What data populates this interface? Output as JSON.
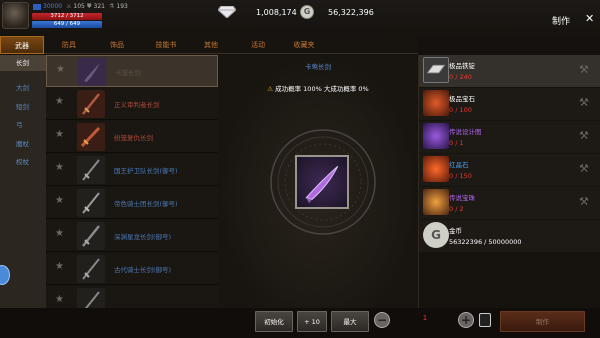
{
  "header": {
    "level_text": "30000",
    "stat1": "105",
    "stat2": "321",
    "stat3": "193",
    "hp": "3712 / 3712",
    "mp": "649 / 649",
    "diamonds": "1,008,174",
    "coin_symbol": "G",
    "gold": "56,322,396",
    "title": "制作",
    "close_glyph": "✕"
  },
  "tabs": [
    {
      "label": "武器"
    },
    {
      "label": "防具"
    },
    {
      "label": "饰品"
    },
    {
      "label": "技能书"
    },
    {
      "label": "其他"
    },
    {
      "label": "活动"
    },
    {
      "label": "收藏夹"
    }
  ],
  "categories": [
    {
      "label": "长剑"
    },
    {
      "label": "大剑"
    },
    {
      "label": "短剑"
    },
    {
      "label": "弓"
    },
    {
      "label": "魔杖"
    },
    {
      "label": "权杖"
    }
  ],
  "items": [
    {
      "name": "卡盟长剑",
      "color": "#5a5046"
    },
    {
      "name": "正义审判者长剑",
      "color": "#b04a3a"
    },
    {
      "name": "纷笼复仇长剑",
      "color": "#b04a3a"
    },
    {
      "name": "国王护卫队长剑(御号)",
      "color": "#4b79b6"
    },
    {
      "name": "帝色骑士团长剑(御号)",
      "color": "#4b79b6"
    },
    {
      "name": "深渊星龙长剑(御号)",
      "color": "#4b79b6"
    },
    {
      "name": "古代骑士长剑(御号)",
      "color": "#4b79b6"
    },
    {
      "name": "",
      "color": "#4b79b6"
    }
  ],
  "detail": {
    "item_name": "卡莺长剑",
    "warn_glyph": "⚠",
    "rates": "成功概率 100% 大成功概率 0%"
  },
  "materials": [
    {
      "name": "极品铁锭",
      "count": "0 / 240",
      "icon": "iron-ingot-icon"
    },
    {
      "name": "极品宝石",
      "count": "0 / 100",
      "icon": "gem-icon"
    },
    {
      "name": "传说设计图",
      "count": "0 / 1",
      "icon": "blueprint-icon"
    },
    {
      "name": "红晶石",
      "count": "0 / 150",
      "icon": "red-crystal-icon"
    },
    {
      "name": "传说宝珠",
      "count": "0 / 2",
      "icon": "orb-icon"
    },
    {
      "name": "金币",
      "count": "56322396 / 50000000",
      "icon": "gold-coin-icon"
    }
  ],
  "bottom": {
    "init_label": "初始化",
    "plus10_label": "+ 10",
    "max_label": "最大",
    "minus_glyph": "−",
    "qty": "1",
    "plus_glyph": "+",
    "craft_label": "制作"
  },
  "colors": {
    "accent_orange": "#c8772f",
    "hp_red": "#c4262a",
    "mp_blue": "#3a78d8",
    "insufficient_red": "#e03d36",
    "legendary_purple": "#b067f0"
  }
}
